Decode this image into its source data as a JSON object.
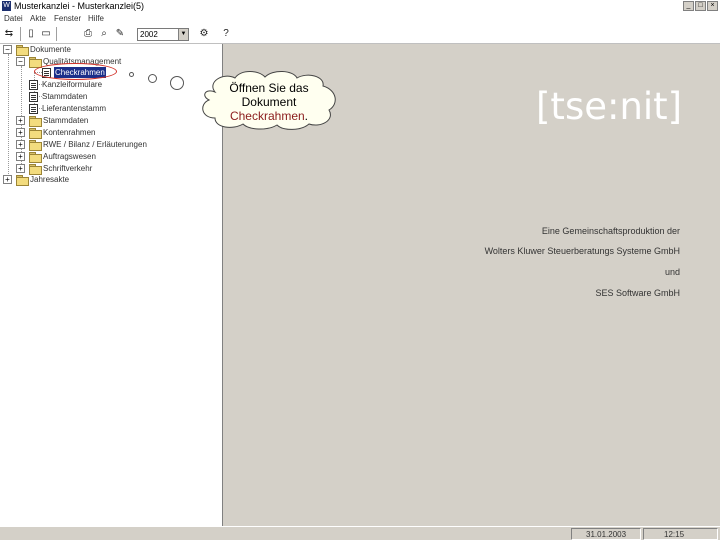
{
  "window": {
    "title": "Musterkanzlei - Musterkanzlei(5)",
    "icon_name": "app-icon",
    "controls": [
      "minimize-icon",
      "maximize-icon",
      "close-icon"
    ]
  },
  "menu": {
    "items": [
      {
        "label": "Datei"
      },
      {
        "label": "Akte"
      },
      {
        "label": "Fenster"
      },
      {
        "label": "Hilfe"
      }
    ]
  },
  "toolbar": {
    "year": "2002",
    "icons": [
      "split-view-icon",
      "new-document-icon",
      "open-folder-icon",
      "print-icon",
      "print-preview-icon",
      "edit-icon",
      "settings-icon",
      "help-icon"
    ]
  },
  "tree": {
    "nodes": [
      {
        "label": "Dokumente",
        "expander": "−",
        "icon": "folder"
      },
      {
        "label": "Qualitätsmanagement",
        "expander": "−",
        "icon": "folder"
      },
      {
        "label": "Checkrahmen",
        "expander": "",
        "icon": "document",
        "selected": true
      },
      {
        "label": "Kanzleiformulare",
        "expander": "",
        "icon": "document"
      },
      {
        "label": "Stammdaten",
        "expander": "",
        "icon": "document"
      },
      {
        "label": "Lieferantenstamm",
        "expander": "",
        "icon": "document"
      },
      {
        "label": "Stammdaten",
        "expander": "+",
        "icon": "folder"
      },
      {
        "label": "Kontenrahmen",
        "expander": "+",
        "icon": "folder"
      },
      {
        "label": "RWE / Bilanz / Erläuterungen",
        "expander": "+",
        "icon": "folder"
      },
      {
        "label": "Auftragswesen",
        "expander": "+",
        "icon": "folder"
      },
      {
        "label": "Schriftverkehr",
        "expander": "+",
        "icon": "folder"
      },
      {
        "label": "Jahresakte",
        "expander": "+",
        "icon": "folder"
      }
    ]
  },
  "callout": {
    "line1": "Öffnen Sie das",
    "line2": "Dokument",
    "link": "Checkrahmen",
    "suffix": ".",
    "link_color": "#8b1c1c"
  },
  "content": {
    "brand": "[tse:nit]",
    "credits": [
      "Eine Gemeinschaftsproduktion der",
      "Wolters Kluwer Steuerberatungs Systeme GmbH",
      "und",
      "SES Software GmbH"
    ]
  },
  "status": {
    "date": "31.01.2003",
    "time": "12:15"
  },
  "colors": {
    "selection": "#1b2f8a",
    "annotation_ellipse": "#d2322a",
    "content_background": "#d4d0c8",
    "brand_text": "#ffffff"
  }
}
